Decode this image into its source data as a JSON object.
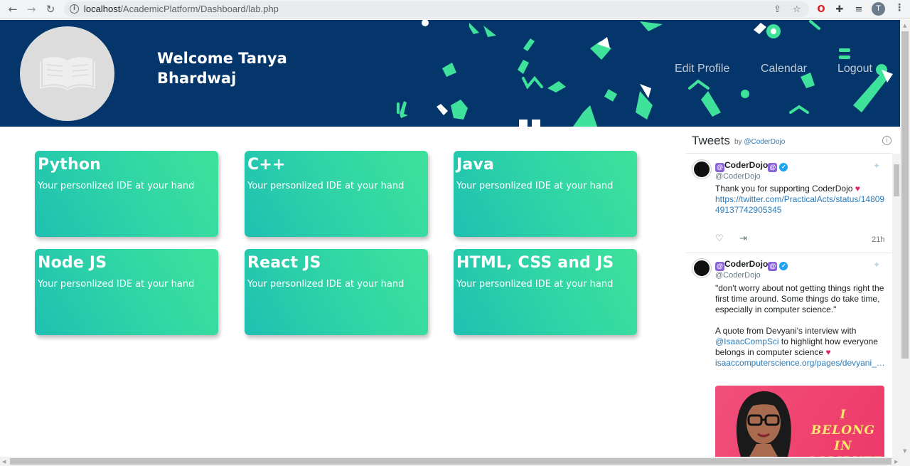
{
  "browser": {
    "url_host": "localhost",
    "url_path": "/AcademicPlatform/Dashboard/lab.php",
    "profile_initial": "T"
  },
  "header": {
    "welcome": "Welcome Tanya Bhardwaj",
    "nav": [
      "Edit Profile",
      "Calendar",
      "Logout"
    ],
    "banner_color": "#04366b",
    "doodle_color": "#3ee29b"
  },
  "cards": [
    {
      "title": "Python",
      "subtitle": "Your personlized IDE at your hand"
    },
    {
      "title": "C++",
      "subtitle": "Your personlized IDE at your hand"
    },
    {
      "title": "Java",
      "subtitle": "Your personlized IDE at your hand"
    },
    {
      "title": "Node JS",
      "subtitle": "Your personlized IDE at your hand"
    },
    {
      "title": "React JS",
      "subtitle": "Your personlized IDE at your hand"
    },
    {
      "title": "HTML, CSS and JS",
      "subtitle": "Your personlized IDE at your hand"
    }
  ],
  "tweets": {
    "title": "Tweets",
    "by_prefix": "by",
    "by_handle": "@CoderDojo",
    "items": [
      {
        "name": "CoderDojo",
        "handle": "@CoderDojo",
        "text": "Thank you for supporting CoderDojo",
        "link": "https://twitter.com/PracticalActs/status/1480949137742905345",
        "time": "21h"
      },
      {
        "name": "CoderDojo",
        "handle": "@CoderDojo",
        "text1": "\"don't worry about not getting things right the first time around. Some things do take time, especially in computer science.\"",
        "text2_prefix": "A quote from Devyani's interview with",
        "text2_mention": "@IsaacCompSci",
        "text2_suffix": "to highlight how everyone belongs in computer science",
        "link": "isaaccomputerscience.org/pages/devyani_…",
        "image_text": "I BELONG IN COMPUTER SCIENCE"
      }
    ]
  }
}
